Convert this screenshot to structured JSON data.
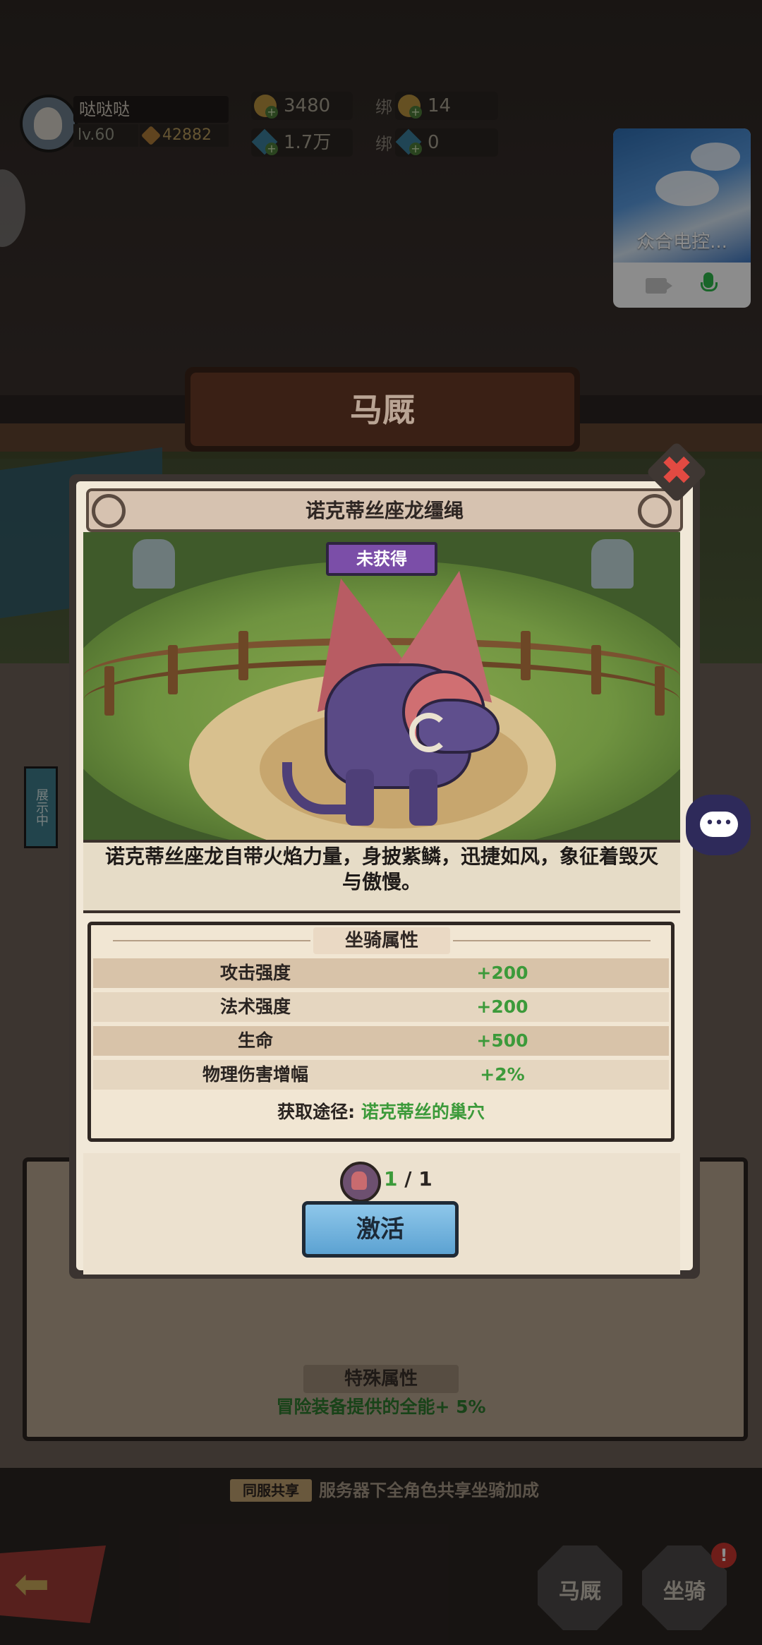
{
  "hud": {
    "player_name": "哒哒哒",
    "level": "lv.60",
    "power": "42882",
    "gold": "3480",
    "gems": "1.7万",
    "bound_label": "绑",
    "bound_gold": "14",
    "bound_gems": "0"
  },
  "video_call": {
    "name": "众合电控..."
  },
  "page_title": "马厩",
  "modal": {
    "title": "诺克蒂丝座龙缰绳",
    "status": "未获得",
    "description": "诺克蒂丝座龙自带火焰力量，身披紫鳞，迅捷如风，象征着毁灭与傲慢。",
    "attributes_title": "坐骑属性",
    "attributes": [
      {
        "name": "攻击强度",
        "value": "+200"
      },
      {
        "name": "法术强度",
        "value": "+200"
      },
      {
        "name": "生命",
        "value": "+500"
      },
      {
        "name": "物理伤害增幅",
        "value": "+2%"
      }
    ],
    "source_label": "获取途径:",
    "source_value": "诺克蒂丝的巢穴",
    "count_have": "1",
    "count_sep": "/",
    "count_need": "1",
    "activate_label": "激活",
    "close_symbol": "✖"
  },
  "background": {
    "special_title": "特殊属性",
    "special_text": "冒险装备提供的全能+ 5%",
    "share_tag": "同服共享",
    "share_text": "服务器下全角色共享坐骑加成",
    "side_tab": "展示中"
  },
  "bottom_nav": {
    "back_symbol": "⬅",
    "stable_label": "马厩",
    "mount_label": "坐骑",
    "badge": "!"
  },
  "colors": {
    "accent_green": "#3c9a3a",
    "status_purple": "#7b4ea8",
    "button_blue": "#5ca2d2",
    "close_red": "#e24a42"
  }
}
